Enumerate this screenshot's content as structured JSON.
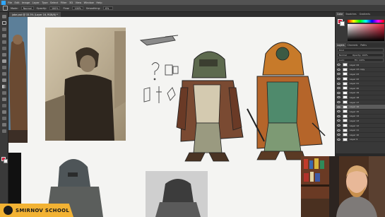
{
  "menubar": {
    "items": [
      "File",
      "Edit",
      "Image",
      "Layer",
      "Type",
      "Select",
      "Filter",
      "3D",
      "View",
      "Window",
      "Help"
    ]
  },
  "options": {
    "mode_label": "Mode:",
    "mode_value": "Normal",
    "opacity_label": "Opacity:",
    "opacity_value": "100%",
    "flow_label": "Flow:",
    "flow_value": "100%",
    "smoothing_label": "Smoothing:",
    "smoothing_value": "0%"
  },
  "document": {
    "tab_label": "jabe.psd @ 33.3% (Layer 16, RGB/8) *"
  },
  "panels": {
    "tabs": [
      "Color",
      "Swatches",
      "Gradients"
    ],
    "layer_tabs": [
      "Layers",
      "Channels",
      "Paths"
    ],
    "kind_label": "Kind",
    "blend_value": "Normal",
    "opacity_label": "Opacity: 100%",
    "lock_label": "Lock:",
    "fill_label": "Fill: 100%",
    "layers": [
      "Layer 24",
      "Layer 23 copy",
      "Layer 23",
      "Layer 22",
      "Layer 21",
      "Layer 20",
      "Layer 19",
      "Layer 18",
      "Layer 17",
      "Layer 16",
      "Layer 15",
      "Layer 14",
      "Layer 13",
      "Layer 12",
      "Layer 11",
      "Layer 10",
      "Layer 9"
    ],
    "selected_index": 9
  },
  "colors": {
    "foreground": "#d61f3e",
    "background": "#ffffff",
    "brand_yellow": "#f2b233"
  },
  "brand": {
    "logo_text": "SMIRNOV SCHOOL"
  }
}
